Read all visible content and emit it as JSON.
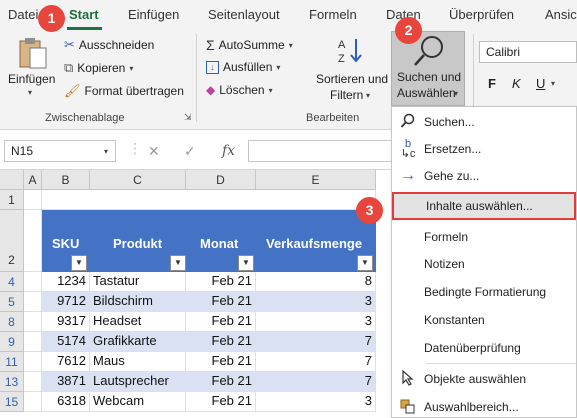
{
  "ribbon_tabs": [
    "Datei",
    "Start",
    "Einfügen",
    "Seitenlayout",
    "Formeln",
    "Daten",
    "Überprüfen",
    "Ansicht"
  ],
  "clipboard": {
    "paste_label": "Einfügen",
    "cut_label": "Ausschneiden",
    "copy_label": "Kopieren",
    "format_painter_label": "Format übertragen",
    "group_label": "Zwischenablage"
  },
  "editing": {
    "autosum_label": "AutoSumme",
    "fill_label": "Ausfüllen",
    "clear_label": "Löschen",
    "sort_filter_line1": "Sortieren und",
    "sort_filter_line2": "Filtern",
    "find_select_line1": "Suchen und",
    "find_select_line2": "Auswählen",
    "group_label": "Bearbeiten"
  },
  "font": {
    "name": "Calibri",
    "bold": "F",
    "italic": "K",
    "underline": "U"
  },
  "formula_bar": {
    "name_box": "N15",
    "cancel_icon": "✕",
    "enter_icon": "✓",
    "fx_label": "fx"
  },
  "columns": [
    "A",
    "B",
    "C",
    "D",
    "E"
  ],
  "table": {
    "headers": [
      "SKU",
      "Produkt",
      "Monat",
      "Verkaufsmenge"
    ],
    "rows": [
      {
        "row": "4",
        "sku": "1234",
        "product": "Tastatur",
        "month": "Feb 21",
        "qty": "8"
      },
      {
        "row": "5",
        "sku": "9712",
        "product": "Bildschirm",
        "month": "Feb 21",
        "qty": "3"
      },
      {
        "row": "8",
        "sku": "9317",
        "product": "Headset",
        "month": "Feb 21",
        "qty": "3"
      },
      {
        "row": "9",
        "sku": "5174",
        "product": "Grafikkarte",
        "month": "Feb 21",
        "qty": "7"
      },
      {
        "row": "11",
        "sku": "7612",
        "product": "Maus",
        "month": "Feb 21",
        "qty": "7"
      },
      {
        "row": "13",
        "sku": "3871",
        "product": "Lautsprecher",
        "month": "Feb 21",
        "qty": "7"
      },
      {
        "row": "15",
        "sku": "6318",
        "product": "Webcam",
        "month": "Feb 21",
        "qty": "3"
      }
    ]
  },
  "row_headers_top": [
    "1",
    "2"
  ],
  "menu": {
    "items": [
      {
        "label": "Suchen...",
        "icon": "search-icon"
      },
      {
        "label": "Ersetzen...",
        "icon": "replace-icon"
      },
      {
        "label": "Gehe zu...",
        "icon": "arrow-right-icon"
      },
      {
        "label": "Inhalte auswählen...",
        "icon": ""
      },
      {
        "label": "Formeln",
        "icon": ""
      },
      {
        "label": "Notizen",
        "icon": ""
      },
      {
        "label": "Bedingte Formatierung",
        "icon": ""
      },
      {
        "label": "Konstanten",
        "icon": ""
      },
      {
        "label": "Datenüberprüfung",
        "icon": ""
      },
      {
        "label": "Objekte auswählen",
        "icon": "pointer-icon"
      },
      {
        "label": "Auswahlbereich...",
        "icon": "selection-pane-icon"
      }
    ]
  },
  "callouts": [
    "1",
    "2",
    "3"
  ],
  "colors": {
    "accent_green": "#1e7145",
    "table_header": "#4472c4",
    "band": "#d9e1f2",
    "callout_red": "#e8453c"
  }
}
